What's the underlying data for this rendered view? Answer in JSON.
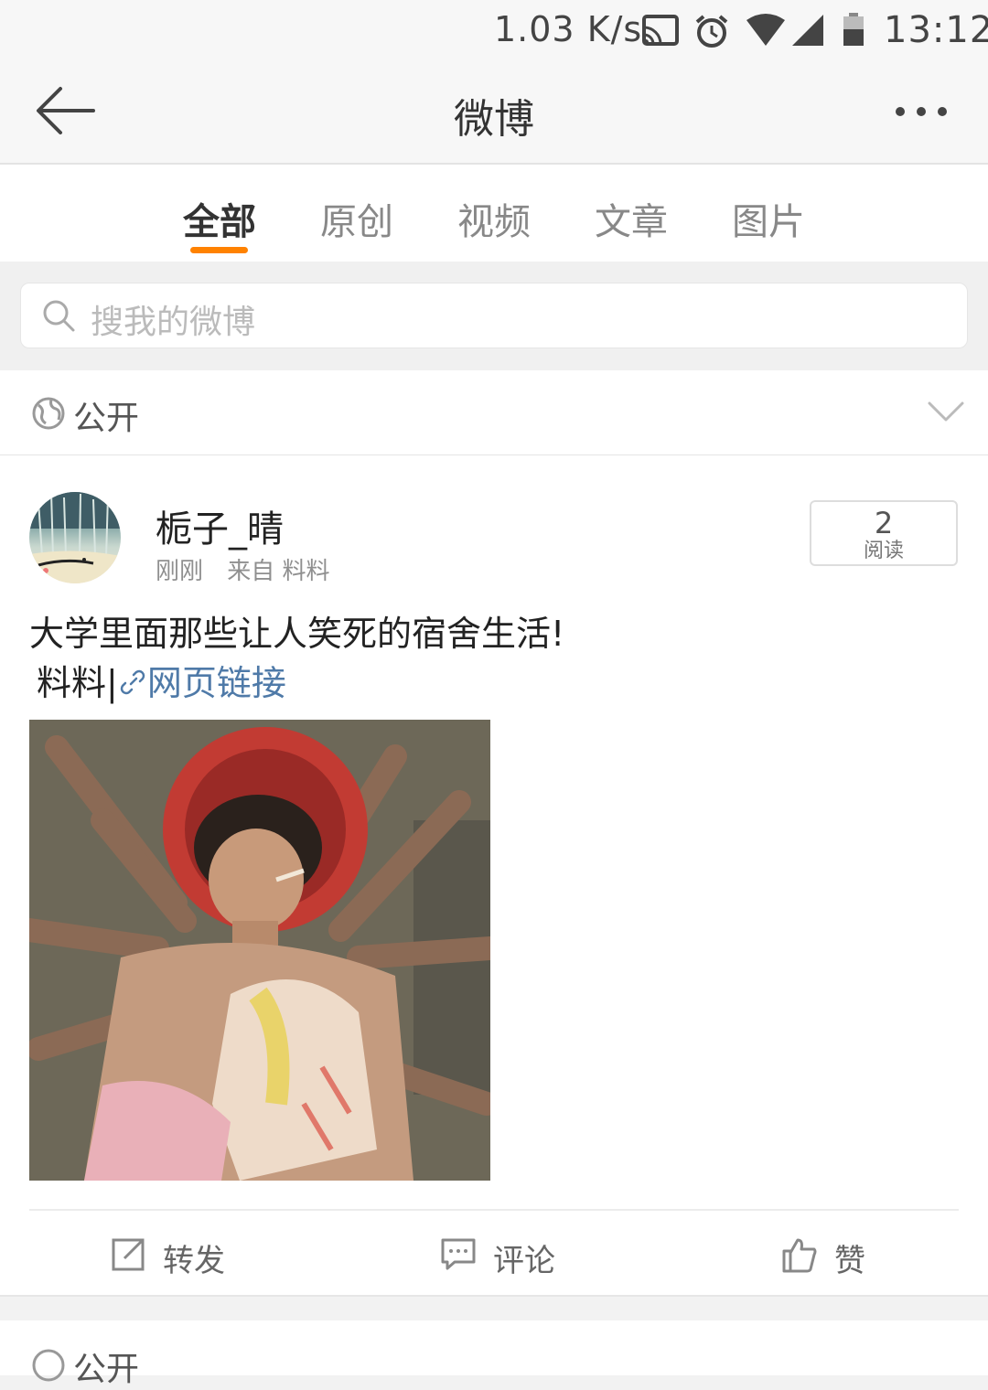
{
  "status_bar": {
    "speed": "1.03 K/s",
    "time": "13:12",
    "icons": [
      "cast-icon",
      "alarm-icon",
      "wifi-icon",
      "signal-icon",
      "battery-icon"
    ]
  },
  "header": {
    "title": "微博",
    "back_icon": "back-arrow-icon",
    "more_icon": "more-icon"
  },
  "tabs": [
    {
      "label": "全部",
      "active": true
    },
    {
      "label": "原创",
      "active": false
    },
    {
      "label": "视频",
      "active": false
    },
    {
      "label": "文章",
      "active": false
    },
    {
      "label": "图片",
      "active": false
    }
  ],
  "search": {
    "placeholder": "搜我的微博"
  },
  "filter": {
    "label": "公开"
  },
  "post": {
    "username": "栀子_晴",
    "time": "刚刚",
    "source": "来自 料料",
    "read_count": "2",
    "read_label": "阅读",
    "text": "大学里面那些让人笑死的宿舍生活!",
    "source_tag": "料料|",
    "link_text": "网页链接",
    "actions": {
      "repost": "转发",
      "comment": "评论",
      "like": "赞"
    }
  },
  "next_card": {
    "label": "公开"
  },
  "colors": {
    "accent": "#ff8200",
    "link": "#4f7aa8"
  }
}
